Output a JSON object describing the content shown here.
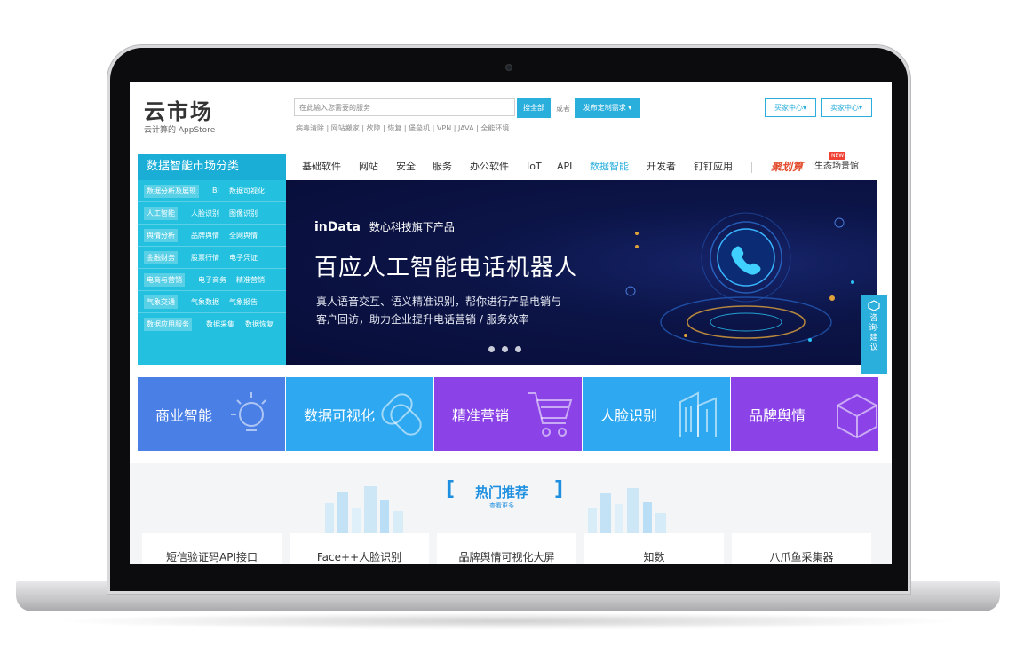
{
  "header": {
    "logo_title": "云市场",
    "logo_subtitle": "云计算的 AppStore",
    "search_placeholder": "在此输入您需要的服务",
    "search_button": "搜全部",
    "or_text": "或者",
    "publish_button": "发布定制需求 ▾",
    "hot_keywords": "病毒清除 | 网站搬家 | 故障 | 恢复 | 堡垒机 | VPN | JAVA | 全能环境",
    "buyer_center": "买家中心▾",
    "seller_center": "卖家中心▾"
  },
  "sidebar": {
    "title": "数据智能市场分类",
    "rows": [
      {
        "tag": "数据分析及展现",
        "items": [
          "BI",
          "数据可视化"
        ]
      },
      {
        "tag": "人工智能",
        "items": [
          "人脸识别",
          "图像识别"
        ]
      },
      {
        "tag": "舆情分析",
        "items": [
          "品牌舆情",
          "全网舆情"
        ]
      },
      {
        "tag": "金融财务",
        "items": [
          "股票行情",
          "电子凭证"
        ]
      },
      {
        "tag": "电商与营销",
        "items": [
          "电子商务",
          "精准营销"
        ]
      },
      {
        "tag": "气象交通",
        "items": [
          "气象数据",
          "气象报告"
        ]
      },
      {
        "tag": "数据应用服务",
        "items": [
          "数据采集",
          "数据恢复"
        ]
      }
    ]
  },
  "nav": {
    "items": [
      "基础软件",
      "网站",
      "安全",
      "服务",
      "办公软件",
      "IoT",
      "API",
      "数据智能",
      "开发者",
      "钉钉应用"
    ],
    "active": "数据智能",
    "juhui": "聚划算",
    "new_badge": "NEW",
    "ecosystem": "生态场景馆"
  },
  "banner": {
    "brand_logo": "inData",
    "brand_text": "数心科技旗下产品",
    "title": "百应人工智能电话机器人",
    "desc_line1": "真人语音交互、语义精准识别，帮你进行产品电销与",
    "desc_line2": "客户回访，助力企业提升电话营销 / 服务效率"
  },
  "tiles": [
    {
      "label": "商业智能",
      "color": "#4a7fe6",
      "icon": "lightbulb-icon"
    },
    {
      "label": "数据可视化",
      "color": "#2ea8f0",
      "icon": "link-chain-icon"
    },
    {
      "label": "精准营销",
      "color": "#8b43e8",
      "icon": "shopping-cart-icon"
    },
    {
      "label": "人脸识别",
      "color": "#2ea8f0",
      "icon": "building-icon"
    },
    {
      "label": "品牌舆情",
      "color": "#8b43e8",
      "icon": "cube-icon"
    }
  ],
  "section": {
    "title": "热门推荐",
    "more": "查看更多"
  },
  "cards": [
    "短信验证码API接口",
    "Face++人脸识别",
    "品牌舆情可视化大屏",
    "知数",
    "八爪鱼采集器"
  ],
  "float_tab": {
    "label": "咨询·建议"
  }
}
